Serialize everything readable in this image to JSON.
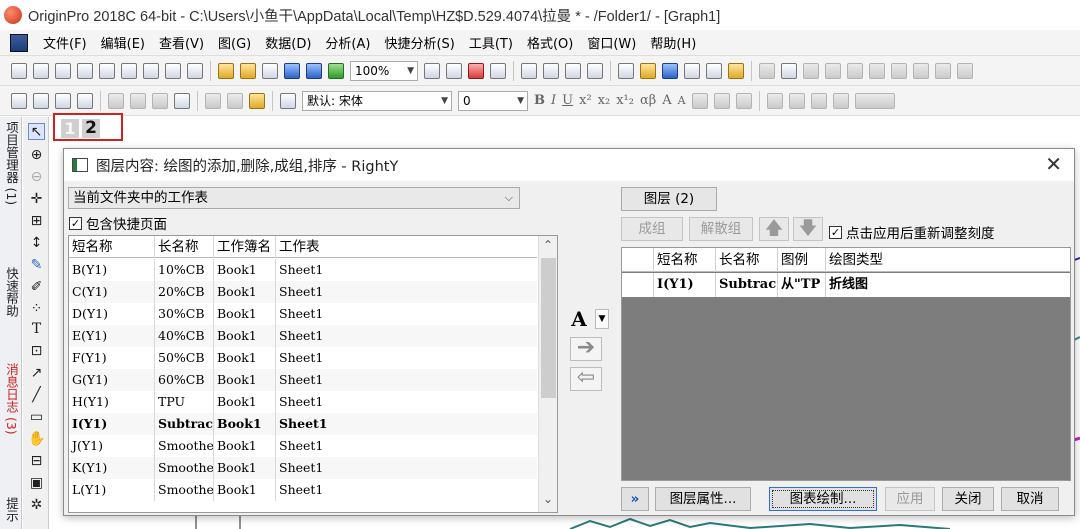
{
  "window": {
    "title": "OriginPro 2018C 64-bit - C:\\Users\\小鱼干\\AppData\\Local\\Temp\\HZ$D.529.4074\\拉曼 * - /Folder1/ - [Graph1]"
  },
  "menu": [
    "文件(F)",
    "编辑(E)",
    "查看(V)",
    "图(G)",
    "数据(D)",
    "分析(A)",
    "快捷分析(S)",
    "工具(T)",
    "格式(O)",
    "窗口(W)",
    "帮助(H)"
  ],
  "toolbar": {
    "zoom": "100%",
    "font_name": "默认: 宋体",
    "font_size": "0",
    "text_buttons": [
      "B",
      "I",
      "U",
      "x²",
      "x₂",
      "x¹₂",
      "αβ",
      "A",
      "A"
    ]
  },
  "side_tabs": {
    "project": "项目管理器 (1)",
    "help": "快速帮助",
    "log": "消息日志 (3)",
    "hint": "提示"
  },
  "layer_tabs": [
    "1",
    "2"
  ],
  "dialog": {
    "title": "图层内容: 绘图的添加,删除,成组,排序 - RightY",
    "source": "当前文件夹中的工作表",
    "include_shortcut": "包含快捷页面",
    "worksheet_table": {
      "headers": [
        "短名称",
        "长名称",
        "工作簿名",
        "工作表"
      ],
      "rows": [
        [
          "B(Y1)",
          "10%CB",
          "Book1",
          "Sheet1"
        ],
        [
          "C(Y1)",
          "20%CB",
          "Book1",
          "Sheet1"
        ],
        [
          "D(Y1)",
          "30%CB",
          "Book1",
          "Sheet1"
        ],
        [
          "E(Y1)",
          "40%CB",
          "Book1",
          "Sheet1"
        ],
        [
          "F(Y1)",
          "50%CB",
          "Book1",
          "Sheet1"
        ],
        [
          "G(Y1)",
          "60%CB",
          "Book1",
          "Sheet1"
        ],
        [
          "H(Y1)",
          "TPU",
          "Book1",
          "Sheet1"
        ],
        [
          "I(Y1)",
          "Subtrac",
          "Book1",
          "Sheet1"
        ],
        [
          "J(Y1)",
          "Smoothe",
          "Book1",
          "Sheet1"
        ],
        [
          "K(Y1)",
          "Smoothe",
          "Book1",
          "Sheet1"
        ],
        [
          "L(Y1)",
          "Smoothe",
          "Book1",
          "Sheet1"
        ]
      ]
    },
    "font_button": "A",
    "layer_label": "图层 (2)",
    "group_button": "成组",
    "ungroup_button": "解散组",
    "rescale_label": "点击应用后重新调整刻度",
    "plot_table": {
      "headers": [
        "短名称",
        "长名称",
        "图例",
        "绘图类型"
      ],
      "rows": [
        [
          "I(Y1)",
          "Subtrac",
          "从\"TP",
          "折线图"
        ]
      ]
    },
    "buttons": {
      "expand": "»",
      "layer_props": "图层属性...",
      "plot_setup": "图表绘制...",
      "apply": "应用",
      "close": "关闭",
      "cancel": "取消"
    }
  }
}
